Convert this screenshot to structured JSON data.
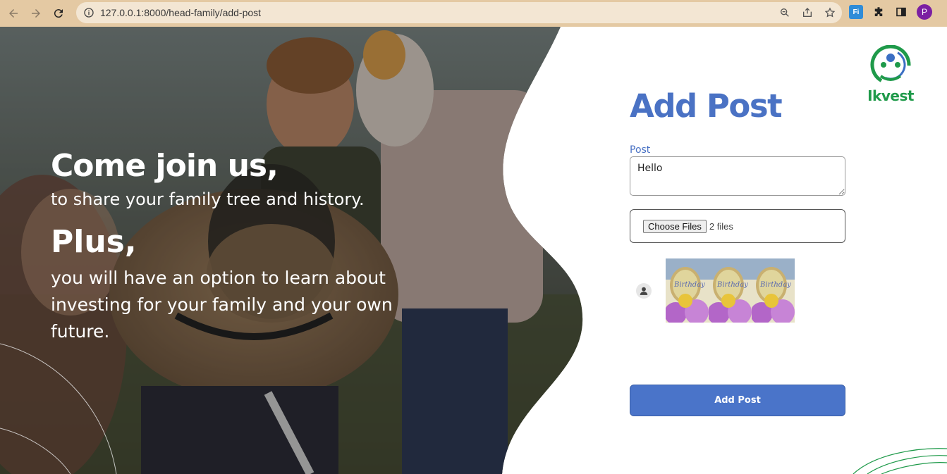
{
  "browser": {
    "url": "127.0.0.1:8000/head-family/add-post",
    "profile_initial": "P",
    "extension_badge": "Fi"
  },
  "hero": {
    "heading_1": "Come join us,",
    "subheading_1": "to share your family tree and history.",
    "heading_2": "Plus,",
    "subheading_2": "you will have an option to learn about investing for your family and your own future."
  },
  "logo": {
    "text": "Ikvest"
  },
  "form": {
    "title": "Add Post",
    "post_label": "Post",
    "post_value": "Hello",
    "file_button": "Choose Files",
    "file_count": "2 files",
    "preview_images": [
      {
        "alt": "birthday-balloons"
      },
      {
        "alt": "birthday-balloons"
      },
      {
        "alt": "birthday-balloons"
      }
    ],
    "submit_label": "Add Post"
  },
  "colors": {
    "accent": "#4a72c4",
    "brand_green": "#1f9a4a",
    "chrome": "#e4c9a3"
  }
}
